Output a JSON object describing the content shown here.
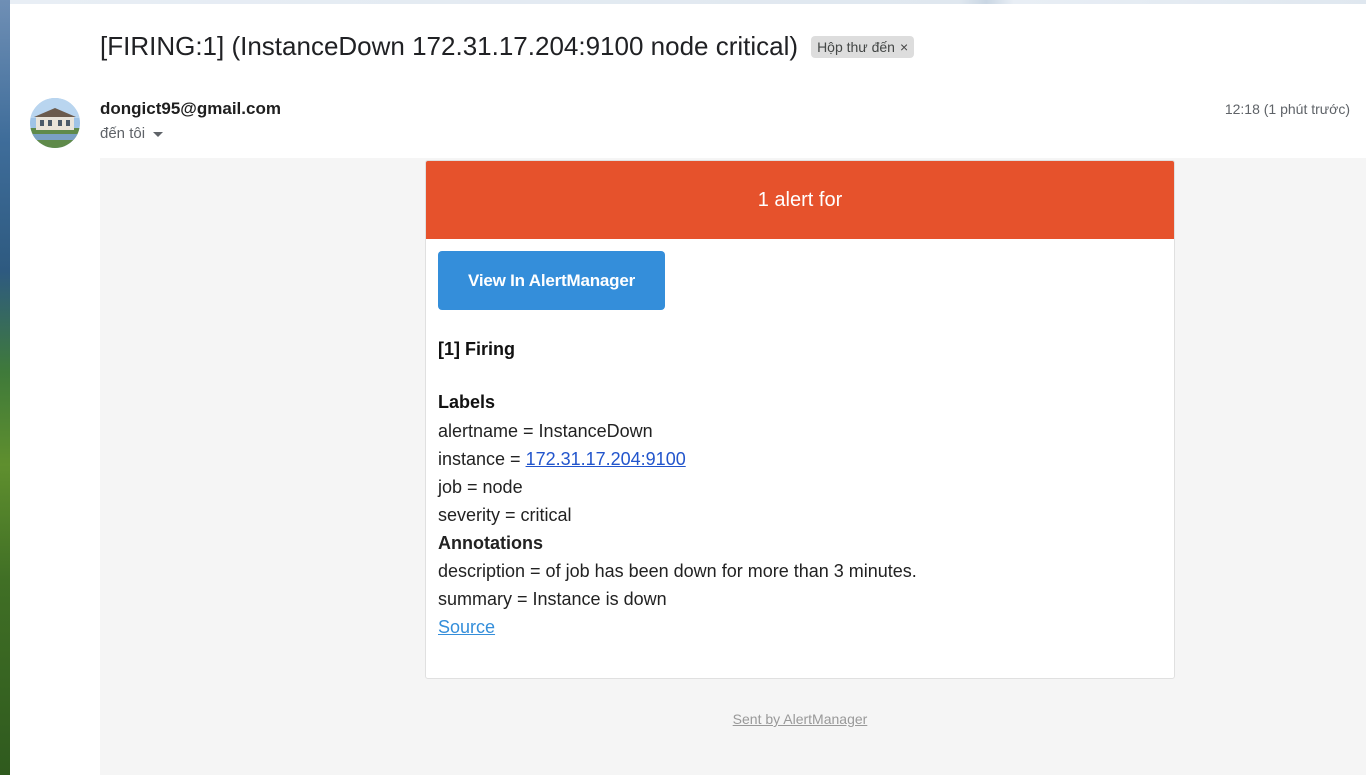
{
  "email": {
    "subject": "[FIRING:1] (InstanceDown 172.31.17.204:9100 node critical)",
    "label_chip": "Hộp thư đến",
    "label_remove": "×",
    "sender": "dongict95@gmail.com",
    "recipient": "đến tôi",
    "timestamp": "12:18 (1 phút trước)"
  },
  "alert": {
    "header": "1 alert for",
    "button_label": "View In AlertManager",
    "firing_title": "[1] Firing",
    "labels_title": "Labels",
    "labels": {
      "alertname": "alertname = InstanceDown",
      "instance_prefix": "instance = ",
      "instance_link": "172.31.17.204:9100",
      "job": "job = node",
      "severity": "severity = critical"
    },
    "annotations_title": "Annotations",
    "annotations": {
      "description": "description = of job has been down for more than 3 minutes.",
      "summary": "summary = Instance is down"
    },
    "source_link": "Source"
  },
  "footer": {
    "text": "Sent by AlertManager"
  },
  "colors": {
    "header_bg": "#e6522c",
    "button_bg": "#348eda",
    "body_bg": "#f5f5f5"
  }
}
